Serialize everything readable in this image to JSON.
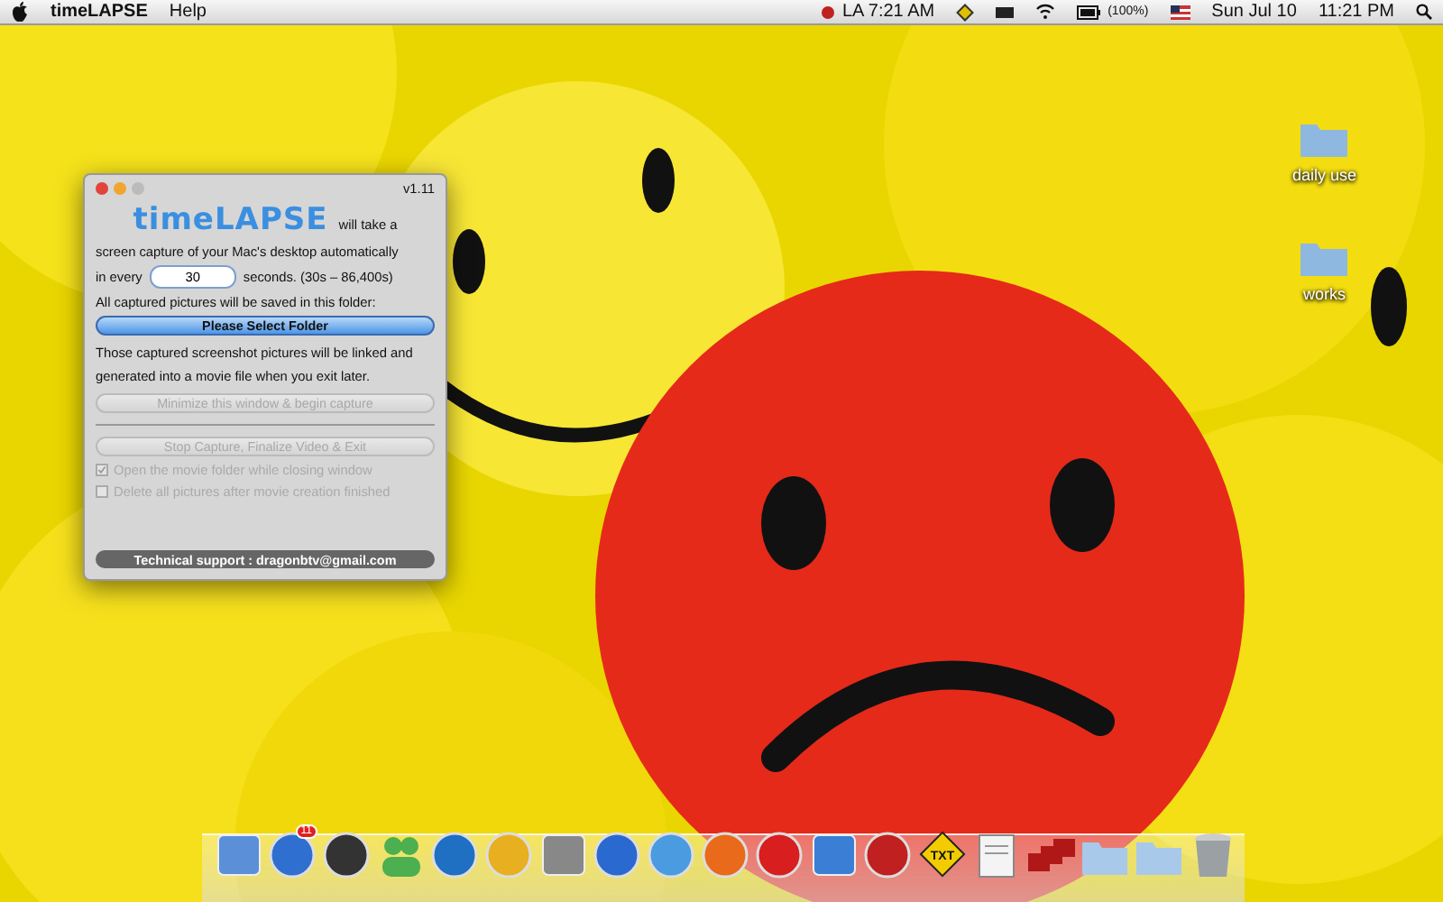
{
  "menu_bar": {
    "app_name": "timeLAPSE",
    "menus": [
      "Help"
    ],
    "clock_la": "LA 7:21 AM",
    "battery": "(100%)",
    "date": "Sun Jul 10",
    "time": "11:21 PM"
  },
  "window": {
    "version": "v1.11",
    "logo": "timeLAPSE",
    "intro_tail": "will take a",
    "intro_line2": "screen capture of your Mac's desktop automatically",
    "interval_prefix": "in every",
    "interval_value": "30",
    "interval_suffix": "seconds.  (30s – 86,400s)",
    "save_note": "All captured pictures will be saved in this folder:",
    "folder_button": {
      "label": "Please Select Folder",
      "disabled": false
    },
    "movie_note": "Those captured screenshot pictures will be linked and generated into a movie file when you exit later.",
    "begin_button": {
      "label": "Minimize this window & begin capture",
      "disabled": true
    },
    "stop_button": {
      "label": "Stop Capture, Finalize Video & Exit",
      "disabled": true
    },
    "options": [
      {
        "label": "Open the movie folder while closing window",
        "checked": true,
        "disabled": true
      },
      {
        "label": "Delete all pictures after movie creation finished",
        "checked": false,
        "disabled": true
      }
    ],
    "support": "Technical support : dragonbtv@gmail.com"
  },
  "desktop_icons": [
    {
      "label": "daily use"
    },
    {
      "label": "works"
    }
  ],
  "dock": [
    {
      "kind": "square",
      "color": "#5b8fd8"
    },
    {
      "kind": "circle",
      "color": "#2f6fd0",
      "badge": "11"
    },
    {
      "kind": "circle",
      "color": "#333333"
    },
    {
      "kind": "people",
      "color": "#4caf50"
    },
    {
      "kind": "circle",
      "color": "#1f6fc2"
    },
    {
      "kind": "circle",
      "color": "#e8b020"
    },
    {
      "kind": "square",
      "color": "#888888"
    },
    {
      "kind": "circle",
      "color": "#2a6ad0"
    },
    {
      "kind": "circle",
      "color": "#4a9be0"
    },
    {
      "kind": "circle",
      "color": "#e86a1a"
    },
    {
      "kind": "circle",
      "color": "#d81e1e"
    },
    {
      "kind": "square",
      "color": "#3a7fd5"
    },
    {
      "kind": "circle",
      "color": "#c02020"
    },
    {
      "kind": "sign",
      "color": "#f2cc00",
      "text": "TXT"
    },
    {
      "kind": "paper",
      "color": "#f4f4f4"
    },
    {
      "kind": "stack",
      "color": "#b01818"
    },
    {
      "kind": "folder",
      "color": "#a9c9ea"
    },
    {
      "kind": "folder",
      "color": "#a9c9ea"
    },
    {
      "kind": "trash",
      "color": "#9aa0a4"
    }
  ]
}
